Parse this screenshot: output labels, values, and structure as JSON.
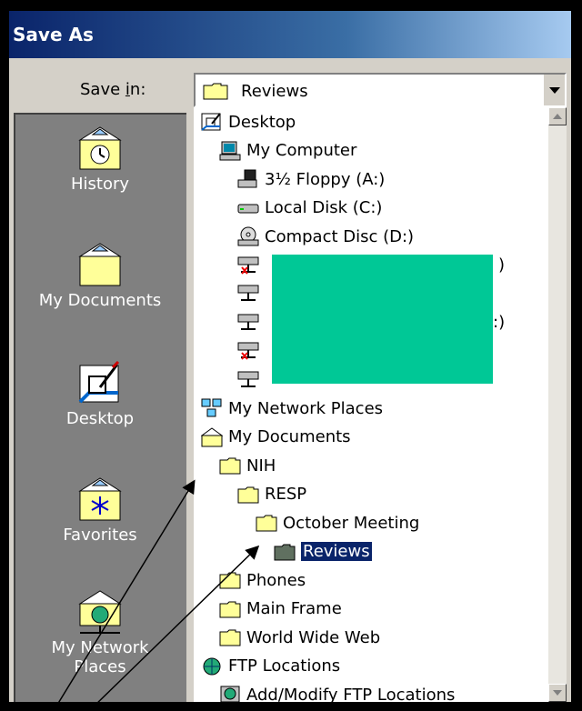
{
  "dialog": {
    "title": "Save As"
  },
  "save_in": {
    "label": "Save in:",
    "mnemonic": "i",
    "value": "Reviews"
  },
  "places": [
    {
      "name": "history",
      "label": "History"
    },
    {
      "name": "my-documents",
      "label": "My Documents"
    },
    {
      "name": "desktop",
      "label": "Desktop"
    },
    {
      "name": "favorites",
      "label": "Favorites"
    },
    {
      "name": "my-network-places",
      "label": "My Network Places"
    }
  ],
  "dropdown_items": [
    {
      "label": "Desktop",
      "icon": "desktop-icon"
    },
    {
      "label": "My Computer",
      "icon": "computer-icon"
    },
    {
      "label": "3½ Floppy (A:)",
      "icon": "floppy-icon"
    },
    {
      "label": "Local Disk (C:)",
      "icon": "disk-icon"
    },
    {
      "label": "Compact Disc (D:)",
      "icon": "cd-icon"
    },
    {
      "label": "",
      "icon": "network-drive-disconnected-icon"
    },
    {
      "label": "",
      "icon": "network-drive-icon"
    },
    {
      "label": "",
      "icon": "network-drive-icon"
    },
    {
      "label": "",
      "icon": "network-drive-disconnected-icon"
    },
    {
      "label": "",
      "icon": "network-drive-icon"
    },
    {
      "label": "My Network Places",
      "icon": "network-places-icon"
    },
    {
      "label": "My Documents",
      "icon": "my-documents-icon"
    },
    {
      "label": "NIH",
      "icon": "folder-icon"
    },
    {
      "label": "RESP",
      "icon": "folder-icon"
    },
    {
      "label": "October Meeting",
      "icon": "folder-icon"
    },
    {
      "label": "Reviews",
      "icon": "open-folder-icon",
      "selected": true
    },
    {
      "label": "Phones",
      "icon": "folder-icon"
    },
    {
      "label": "Main Frame",
      "icon": "folder-icon"
    },
    {
      "label": "World Wide Web",
      "icon": "folder-icon"
    },
    {
      "label": "FTP Locations",
      "icon": "ftp-icon"
    },
    {
      "label": "Add/Modify FTP Locations",
      "icon": "ftp-add-icon"
    }
  ],
  "partial_text": [
    ")",
    ":)"
  ],
  "colors": {
    "title_bar": "#0a246a",
    "selection": "#0a246a",
    "redaction": "#00c896",
    "places_bar": "#808080"
  }
}
